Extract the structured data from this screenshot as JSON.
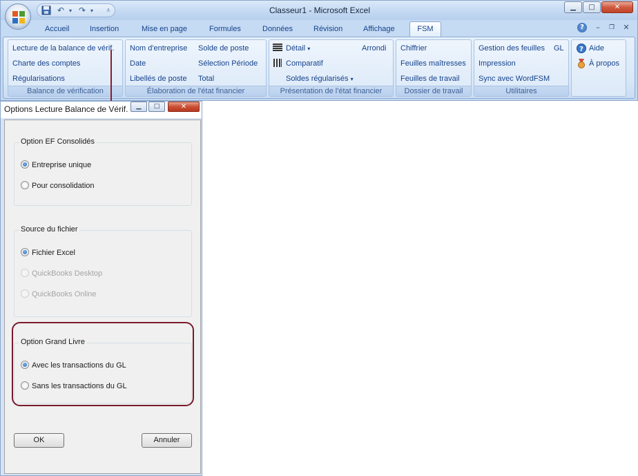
{
  "window": {
    "title": "Classeur1 - Microsoft Excel",
    "controls": {
      "minimize": "▁",
      "maximize": "□",
      "close": "✕"
    }
  },
  "qat": {
    "save_icon": "save-icon",
    "undo_icon": "undo-icon",
    "redo_icon": "redo-icon",
    "customize_icon": "customize-qat-icon"
  },
  "tabs": [
    {
      "label": "Accueil"
    },
    {
      "label": "Insertion"
    },
    {
      "label": "Mise en page"
    },
    {
      "label": "Formules"
    },
    {
      "label": "Données"
    },
    {
      "label": "Révision"
    },
    {
      "label": "Affichage"
    },
    {
      "label": "FSM",
      "active": true
    }
  ],
  "ribbon": {
    "groups": [
      {
        "label": "Balance de vérification",
        "buttons": [
          "Lecture de la balance de vérif.",
          "Charte des comptes",
          "Régularisations"
        ]
      },
      {
        "label": "Élaboration de l'état financier",
        "buttons": [
          "Nom d'entreprise",
          "Date",
          "Libellés de poste",
          "Solde de poste",
          "Sélection Période",
          "Total"
        ]
      },
      {
        "label": "Présentation de l'état financier",
        "buttons": [
          "Détail",
          "Comparatif",
          "Soldes régularisés",
          "Arrondi"
        ]
      },
      {
        "label": "Dossier de travail",
        "buttons": [
          "Chiffrier",
          "Feuilles maîtresses",
          "Feuilles de travail"
        ]
      },
      {
        "label": "Utilitaires",
        "buttons": [
          "Gestion des feuilles",
          "GL",
          "Impression",
          "Sync avec WordFSM"
        ]
      },
      {
        "label": "",
        "buttons": [
          "Aide",
          "À propos"
        ]
      }
    ]
  },
  "dialog": {
    "title": "Options Lecture Balance de Vérif.",
    "groups": [
      {
        "title": "Option EF Consolidés",
        "options": [
          {
            "label": "Entreprise unique",
            "selected": true,
            "enabled": true
          },
          {
            "label": "Pour consolidation",
            "selected": false,
            "enabled": true
          }
        ]
      },
      {
        "title": "Source du fichier",
        "options": [
          {
            "label": "Fichier Excel",
            "selected": true,
            "enabled": true
          },
          {
            "label": "QuickBooks Desktop",
            "selected": false,
            "enabled": false
          },
          {
            "label": "QuickBooks Online",
            "selected": false,
            "enabled": false
          }
        ]
      },
      {
        "title": "Option Grand Livre",
        "options": [
          {
            "label": "Avec les transactions du GL",
            "selected": true,
            "enabled": true
          },
          {
            "label": "Sans les transactions du GL",
            "selected": false,
            "enabled": true
          }
        ]
      }
    ],
    "ok_label": "OK",
    "cancel_label": "Annuler"
  },
  "colors": {
    "highlight": "#7a1a2a",
    "ribbon_text": "#15428b",
    "radio_selected": "#1b5fb7"
  }
}
